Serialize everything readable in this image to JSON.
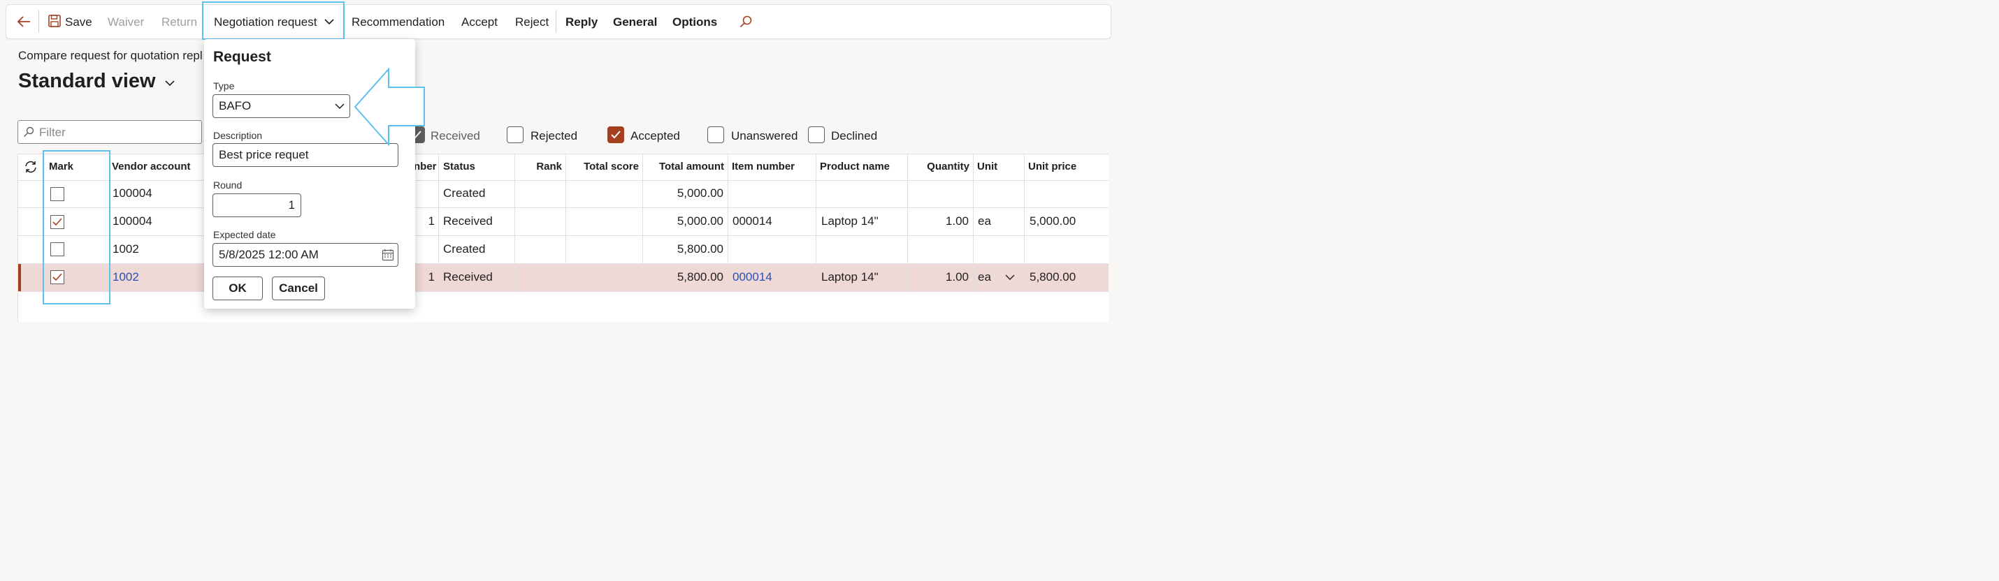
{
  "toolbar": {
    "back_icon": "arrow-left-icon",
    "save_icon": "floppy-disk-icon",
    "save_label": "Save",
    "waiver_label": "Waiver",
    "return_label": "Return",
    "negotiation_label": "Negotiation request",
    "recommendation_label": "Recommendation",
    "accept_label": "Accept",
    "reject_label": "Reject",
    "reply_label": "Reply",
    "general_label": "General",
    "options_label": "Options",
    "search_icon": "search-icon"
  },
  "page": {
    "subtitle": "Compare request for quotation repl",
    "view_title": "Standard view"
  },
  "filter": {
    "placeholder": "Filter"
  },
  "status_filters": [
    {
      "label": "Received",
      "checked": true
    },
    {
      "label": "Rejected",
      "checked": false
    },
    {
      "label": "Accepted",
      "checked": true
    },
    {
      "label": "Unanswered",
      "checked": false
    },
    {
      "label": "Declined",
      "checked": false
    }
  ],
  "grid": {
    "headers": {
      "mark": "Mark",
      "vendor_account": "Vendor account",
      "number_partial": "nber",
      "status": "Status",
      "rank": "Rank",
      "total_score": "Total score",
      "total_amount": "Total amount",
      "item_number": "Item number",
      "product_name": "Product name",
      "quantity": "Quantity",
      "unit": "Unit",
      "unit_price": "Unit price"
    },
    "rows": [
      {
        "mark": false,
        "vendor": "100004",
        "num": "",
        "status": "Created",
        "total_amount": "5,000.00",
        "item": "",
        "product": "",
        "quantity": "",
        "unit": "",
        "unit_price": ""
      },
      {
        "mark": true,
        "vendor": "100004",
        "num": "1",
        "status": "Received",
        "total_amount": "5,000.00",
        "item": "000014",
        "product": "Laptop 14\"",
        "quantity": "1.00",
        "unit": "ea",
        "unit_price": "5,000.00"
      },
      {
        "mark": false,
        "vendor": "1002",
        "num": "",
        "status": "Created",
        "total_amount": "5,800.00",
        "item": "",
        "product": "",
        "quantity": "",
        "unit": "",
        "unit_price": ""
      },
      {
        "mark": true,
        "vendor": "1002",
        "num": "1",
        "status": "Received",
        "total_amount": "5,800.00",
        "item": "000014",
        "product": "Laptop 14\"",
        "quantity": "1.00",
        "unit": "ea",
        "unit_price": "5,800.00"
      }
    ]
  },
  "dialog": {
    "title": "Request",
    "type_label": "Type",
    "type_value": "BAFO",
    "description_label": "Description",
    "description_value": "Best price requet",
    "round_label": "Round",
    "round_value": "1",
    "expected_date_label": "Expected date",
    "expected_date_value": "5/8/2025 12:00 AM",
    "ok_label": "OK",
    "cancel_label": "Cancel"
  },
  "colors": {
    "accent": "#a4401f",
    "highlight": "#5bc2f0",
    "link": "#2b4fb3",
    "selected_row": "#efd9d6"
  }
}
